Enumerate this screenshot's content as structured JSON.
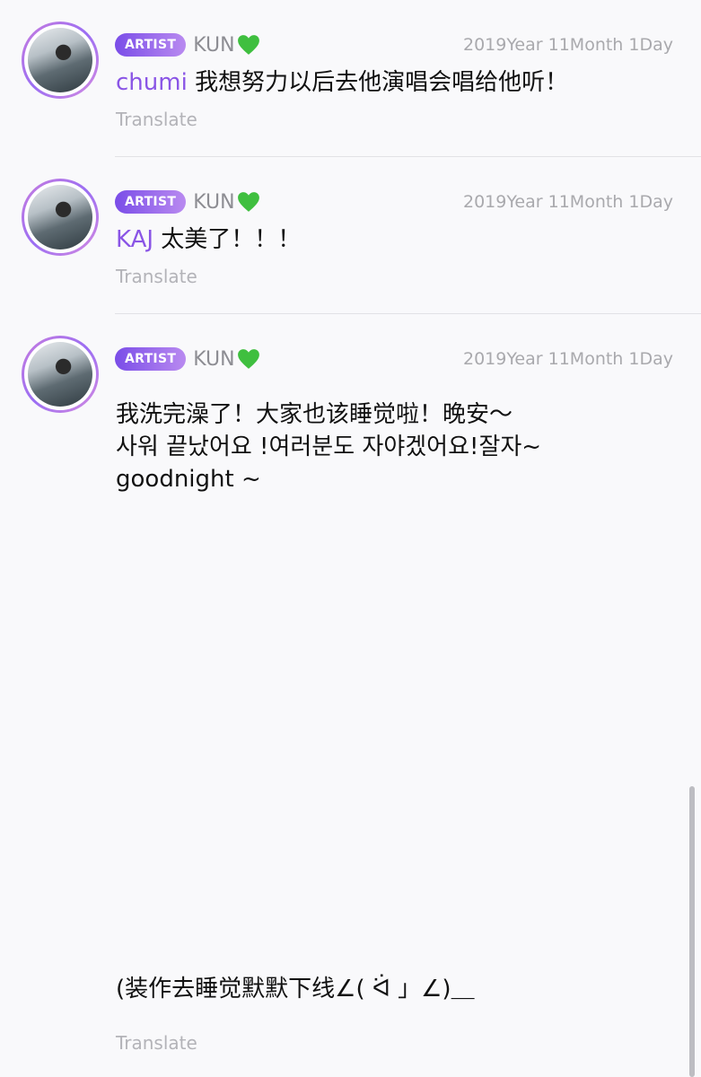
{
  "posts": [
    {
      "badge": "ARTIST",
      "author": "KUN",
      "date": "2019Year 11Month 1Day",
      "mention": "chumi",
      "text": " 我想努力以后去他演唱会唱给他听！",
      "translate": "Translate"
    },
    {
      "badge": "ARTIST",
      "author": "KUN",
      "date": "2019Year 11Month 1Day",
      "mention": "KAJ",
      "text": " 太美了！！！",
      "translate": "Translate"
    },
    {
      "badge": "ARTIST",
      "author": "KUN",
      "date": "2019Year 11Month 1Day",
      "lines": [
        "我洗完澡了！大家也该睡觉啦！晚安～",
        "사워 끝났어요 !여러분도 자야겠어요!잘자~",
        "goodnight ~"
      ],
      "tail": "(装作去睡觉默默下线∠( ᐛ 」∠)＿",
      "translate": "Translate"
    }
  ],
  "icons": {
    "heart": "green-heart-icon"
  },
  "colors": {
    "badge_start": "#7a4de8",
    "badge_end": "#b98af0",
    "mention": "#8a55e6",
    "heart": "#3fbf3f"
  }
}
